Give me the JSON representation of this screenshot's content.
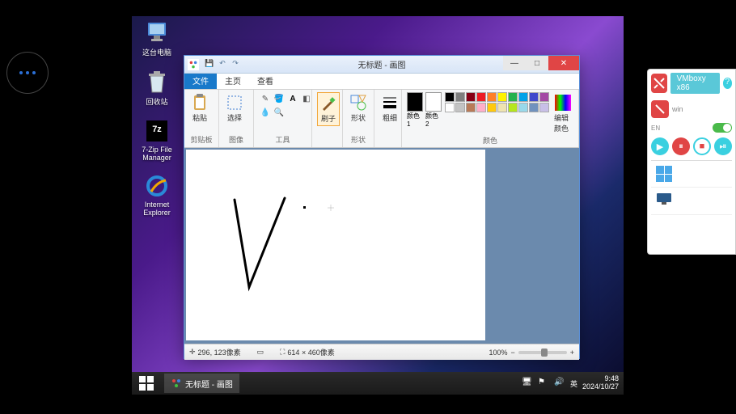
{
  "dots_button": "more-options",
  "desktop": {
    "icons": [
      {
        "name": "this-pc",
        "label": "这台电脑"
      },
      {
        "name": "recycle-bin",
        "label": "回收站"
      },
      {
        "name": "7zip",
        "label": "7-Zip File Manager"
      },
      {
        "name": "ie",
        "label": "Internet Explorer"
      }
    ]
  },
  "paint": {
    "title": "无标题 - 画图",
    "tabs": {
      "file": "文件",
      "home": "主页",
      "view": "查看"
    },
    "groups": {
      "clipboard": {
        "label": "剪贴板",
        "paste": "粘贴",
        "select": "选择"
      },
      "image": {
        "label": "图像"
      },
      "tools": {
        "label": "工具"
      },
      "brushes": {
        "label": "刷子",
        "btn": "刷子"
      },
      "shapes": {
        "label": "形状",
        "btn": "形状"
      },
      "size": {
        "label": "",
        "btn": "粗细"
      },
      "colors": {
        "label": "颜色",
        "c1": "颜色 1",
        "c2": "颜色 2",
        "edit": "编辑颜色"
      }
    },
    "palette_row1": [
      "#000",
      "#7f7f7f",
      "#880015",
      "#ed1c24",
      "#ff7f27",
      "#fff200",
      "#22b14c",
      "#00a2e8",
      "#3f48cc",
      "#a349a4"
    ],
    "palette_row2": [
      "#fff",
      "#c3c3c3",
      "#b97a57",
      "#ffaec9",
      "#ffc90e",
      "#efe4b0",
      "#b5e61d",
      "#99d9ea",
      "#7092be",
      "#c8bfe7"
    ],
    "status": {
      "pos": "296, 123像素",
      "size": "614 × 460像素",
      "zoom": "100%"
    }
  },
  "taskbar": {
    "task": "无标题 - 画图",
    "ime": "英",
    "time": "9:48",
    "date": "2024/10/27"
  },
  "side_panel": {
    "title": "VMboxy x86",
    "sub": "win",
    "toggle": "EN"
  }
}
